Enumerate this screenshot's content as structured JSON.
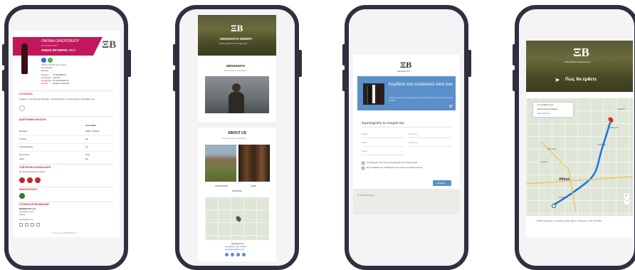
{
  "phone1": {
    "header_title": "ΟΝΟΜΑ ΟΙΝΟΠΟΙΕΙΟΥ",
    "header_sub": "ΣΤΟΙΧΕΙΑ ΟΙΝΟΥ",
    "wine_name": "ΟΙΝΟΣ ΕΡΥΘΡΟΣ",
    "wine_year": "2021",
    "meta_lines": [
      "750ml | 13.5% vol | Ξηρός",
      "Νέα Καρδιά",
      "Ελλάδα"
    ],
    "info_labels": [
      "Ποικιλία",
      "Κατηγορία",
      "Σερβίρισμα",
      "Ετικέτα"
    ],
    "info_values": [
      "ΣΥΡΑ/ΜΕΡΛΟ",
      "ΞΗΡΟΣ",
      "16-18 ΒΑΘΜΟΥΣ",
      "ΑΡΙΘΜ. 001/2021"
    ],
    "ingredients_title": "ΣΥΣΤΑΤΙΚΑ",
    "ingredients_text": "Σταφύλια, συντηρητικά (θειώδη), περιέχει θειώδη. Οξυντηρητικά: ασκορβικό οξύ.",
    "nutrition_title": "ΔΙΑΤΡΟΦΙΚΗ ΔΗΛΩΣΗ",
    "nutrition_col": "Ανά 100ml",
    "nutrition_rows": [
      {
        "label": "Ενέργεια",
        "value": "340kJ / 82kcal"
      },
      {
        "label": "Λιπαρά",
        "value": "0g"
      },
      {
        "label": "Υδατάνθρακες",
        "value": "1g"
      },
      {
        "label": "Πρωτεΐνες",
        "value": "0.1g"
      },
      {
        "label": "Αλάτι",
        "value": "0g"
      }
    ],
    "responsible_title": "ΥΠΕΥΘΥΝΗ ΚΑΤΑΝΑΛΩΣΗ",
    "responsible_text": "Να καταναλώνεται με μέτρο.",
    "recycle_title": "ΑΝΑΚΥΚΛΩΣΗ",
    "contact_title": "ΣΤΟΙΧΕΙΑ ΕΠΙΚΟΙΝΩΝΙΑΣ",
    "contact_lines": [
      "DENSIGHTS Α.Ε.",
      "Λεωφόρος 123",
      "Αθήνα"
    ],
    "website": "densights.com",
    "footer": "Powered by DENSIGHTS"
  },
  "phone2": {
    "hero_title": "DENSIGHTS WINERY",
    "hero_sub": "Καλώς ήρθατε στο κτήμα μας",
    "section1_title": "DENSIGHTS",
    "section1_text": "Οινοποιείο με παράδοση",
    "about_title": "ABOUT US",
    "about_text": "Γνωρίστε την ιστορία μας",
    "card_labels": [
      "ΟΙΝΟΠΟΙΕΙΟ",
      "ΚΑΒΑ"
    ],
    "contact_lines": [
      "DENSIGHTS",
      "Λεωφόρος 123, Αθήνα",
      "info@densights.com"
    ]
  },
  "phone3": {
    "brand": "DENSIGHTS",
    "banner_title": "Κερδίστε ένα συλλεκτικό wine box",
    "banner_text": "Λάβετε μέρος στον διαγωνισμό και κερδίστε ένα κουτί με συλλεκτικά κρασιά.",
    "form_title": "Συμπληρώστε τα στοιχεία σας",
    "fields": [
      "Όνομα",
      "Επώνυμο",
      "Email",
      "Τηλέφωνο",
      "Ηλικία"
    ],
    "consent_1": "Αποδέχομαι τους όρους συμμετοχής στον διαγωνισμό",
    "consent_2": "Έχω διαβάσει και αποδέχομαι τους όρους του διαγωνισμού",
    "submit_label": "Υποβολή",
    "footer": "© 2022 Densights"
  },
  "phone4": {
    "hero_sub": "ΟΙΝΟΠΟΙΕΙΟ DENSIGHTS",
    "hero_title": "Πώς θα έρθετε",
    "route_items": [
      "Η τοποθεσία σας",
      "Οινοποιείο Densights",
      "Περισσότερα"
    ],
    "map_labels": [
      "Αθήνα",
      "Αιγάλεω",
      "Χαλάνδρι",
      "Μαρούσι",
      "Κηφισιά",
      "Περιστέρι",
      "Καλλιθέα"
    ],
    "footer": "© 2022 Densights | Λεωφόρος 299, Αθήνα | Τηλέφωνο: 210 123 4567"
  },
  "colors": {
    "accent": "#c2185b",
    "banner": "#5a8fca",
    "phone_frame": "#2f2f3f",
    "route": "#1a73e8"
  }
}
